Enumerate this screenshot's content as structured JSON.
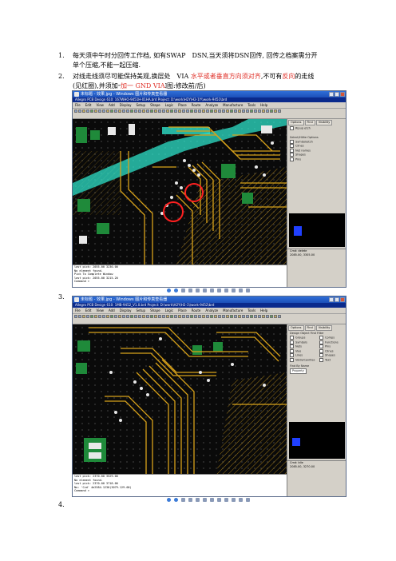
{
  "items": [
    {
      "num": "1.",
      "lines": [
        "每天须中午时分回传工作档, 如有SWAP　DSN,当天须将DSN回传, 回传之档案需分开",
        "单个压缩,不能一起压缩."
      ]
    },
    {
      "num": "2.",
      "lines": [
        "对线走线须尽可能保持美观,换层处　VIA",
        "(见红圈),并须加一 GND VIA.(如图:修改前/后)"
      ]
    },
    {
      "num": "3."
    },
    {
      "num": "4."
    }
  ],
  "item2_red1": "水平或者垂直方向须对齐",
  "item2_mid": ",不可有",
  "item2_red2": "反向",
  "item2_tail": "的走线",
  "item2_red3": "加一 GND VIA",
  "screenshot1": {
    "title": "未标题 - 效果.jpg - Windows 图片和传真查看器",
    "app_title": "Allegro PCB Design 610: 167WHO-9451H-01HA.brd  Project: D:\\work\\H2Y\\H2-1Y\\\\work-9451\\brd",
    "menu": [
      "File",
      "Edit",
      "View",
      "Add",
      "Display",
      "Setup",
      "Shape",
      "Logic",
      "Place",
      "Route",
      "Analyze",
      "Manufacture",
      "Tools",
      "Help"
    ],
    "tabs": [
      "Options",
      "Find",
      "Visibility"
    ],
    "side_lines": [
      "Ripup etch",
      "Select/Hilite Options",
      "Symbol/etch",
      "Clines",
      "Net names",
      "Shapes",
      "Pins"
    ],
    "cmd_lines": [
      "last pick: 2055.00  3230.00",
      "No element found.",
      "Pick To Complete Window",
      "last pick: 2055.00  3215.20",
      "Command >"
    ],
    "status": [
      "Cmd: delete",
      "2085.00, 3305.00"
    ]
  },
  "screenshot2": {
    "title": "未标题 - 效果.jpg - Windows 图片和传真查看器",
    "app_title": "Allegro PCB Design 610: 1MB-9452_V1.0.brd  Project: D:\\work\\H2Y\\H2-1\\\\work-9452\\brd",
    "menu": [
      "File",
      "Edit",
      "View",
      "Add",
      "Display",
      "Setup",
      "Shape",
      "Logic",
      "Place",
      "Route",
      "Analyze",
      "Manufacture",
      "Tools",
      "Help"
    ],
    "tabs": [
      "Options",
      "Find",
      "Visibility"
    ],
    "side_lines": [
      "Design Object Find Filter",
      "Groups",
      "Comps",
      "Symbols",
      "Functions",
      "Nets",
      "Pins",
      "Vias",
      "Clines",
      "Lines",
      "Shapes",
      "Voids/Cavities",
      "Text",
      "Find By Name",
      "Property"
    ],
    "cmd_lines": [
      "last pick: 2370.00  3529.00",
      "No element found.",
      "last pick: 2370.00  3718.00",
      "No: 'Cvd' 4e2584.1230(3079.129.00)",
      "Command >"
    ],
    "status": [
      "Cmd: Idle",
      "2085.00, 3270.00"
    ]
  },
  "colors": {
    "red": "#e0322a",
    "pcb_bg": "#0a0a0a",
    "trace": "#d8a21a",
    "plane": "#2ee0c8"
  }
}
